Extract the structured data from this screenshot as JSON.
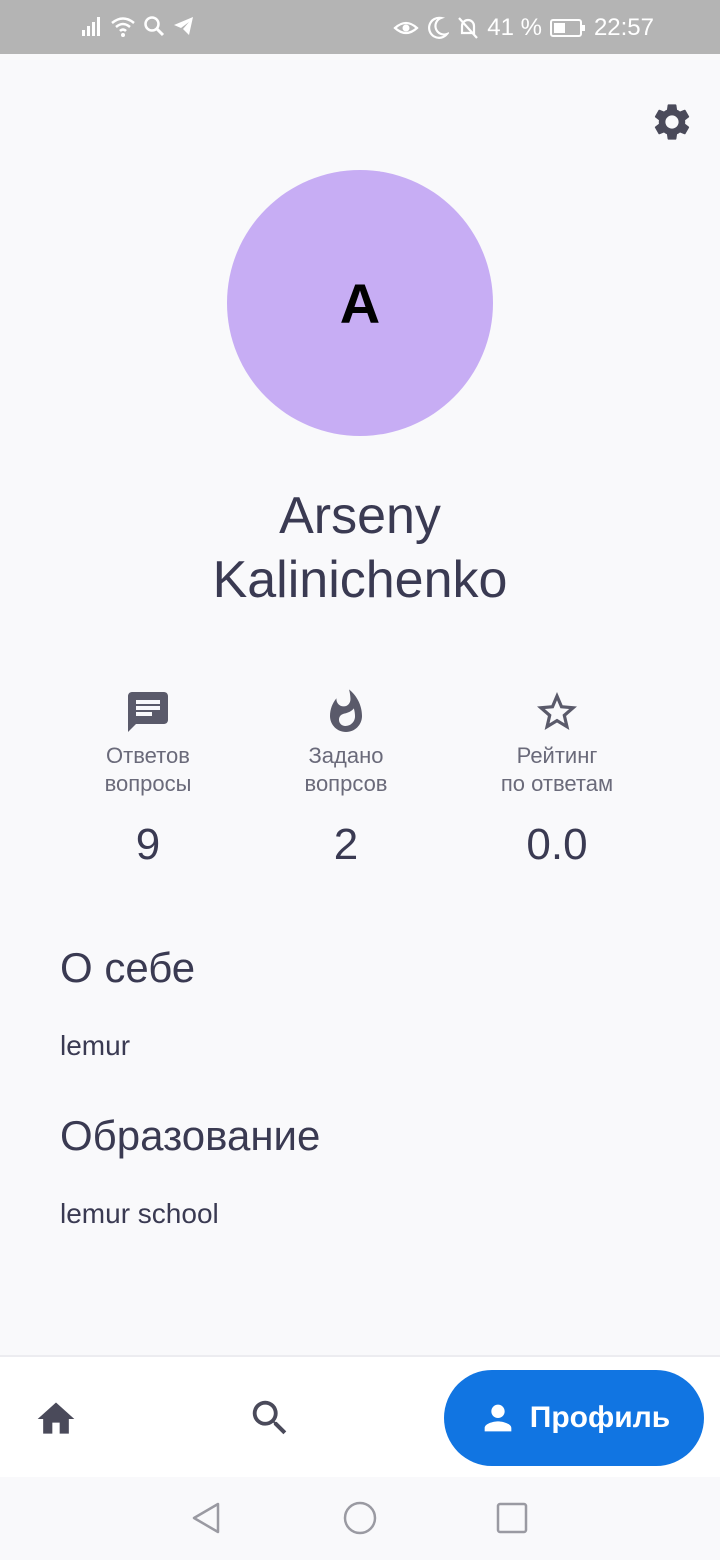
{
  "status_bar": {
    "battery": "41 %",
    "time": "22:57"
  },
  "profile": {
    "avatar_letter": "A",
    "name_line1": "Arseny",
    "name_line2": "Kalinichenko",
    "avatar_color": "#c7adf4"
  },
  "stats": [
    {
      "icon": "chat-icon",
      "label_line1": "Ответов",
      "label_line2": "вопросы",
      "value": "9"
    },
    {
      "icon": "flame-icon",
      "label_line1": "Задано",
      "label_line2": "вопрсов",
      "value": "2"
    },
    {
      "icon": "star-icon",
      "label_line1": "Рейтинг",
      "label_line2": "по ответам",
      "value": "0.0"
    }
  ],
  "about": {
    "title": "О себе",
    "text": "lemur"
  },
  "education": {
    "title": "Образование",
    "text": "lemur school"
  },
  "nav": {
    "profile_label": "Профиль",
    "accent": "#1175e2"
  }
}
